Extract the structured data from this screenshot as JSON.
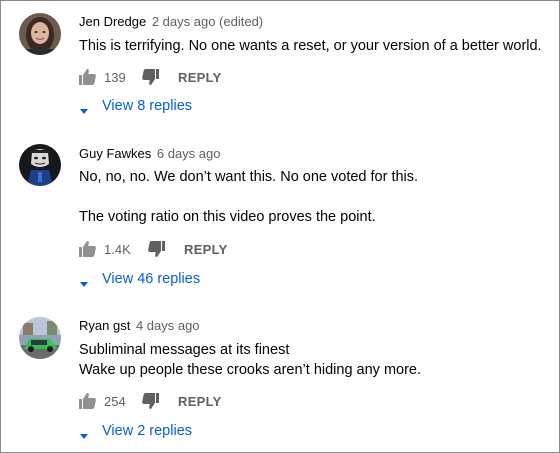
{
  "comments": [
    {
      "author": "Jen Dredge",
      "meta": "2 days ago (edited)",
      "lines": "This is terrifying. No one wants a reset, or your version of a better world.",
      "likes": "139",
      "reply_label": "REPLY",
      "replies_label": "View 8 replies",
      "avatar_icon": "user-avatar-woman-icon"
    },
    {
      "author": "Guy Fawkes",
      "meta": "6 days ago",
      "lines": "No, no, no. We don’t want this. No one voted for this.\n\nThe voting ratio on this video proves the point.",
      "likes": "1.4K",
      "reply_label": "REPLY",
      "replies_label": "View 46 replies",
      "avatar_icon": "user-avatar-mask-icon"
    },
    {
      "author": "Ryan gst",
      "meta": "4 days ago",
      "lines": "Subliminal messages at its finest\nWake up people these crooks aren’t hiding any more.",
      "likes": "254",
      "reply_label": "REPLY",
      "replies_label": "View 2 replies",
      "avatar_icon": "user-avatar-car-icon"
    }
  ],
  "colors": {
    "link_blue": "#065fd4",
    "meta_gray": "#606060",
    "text": "#030303"
  }
}
